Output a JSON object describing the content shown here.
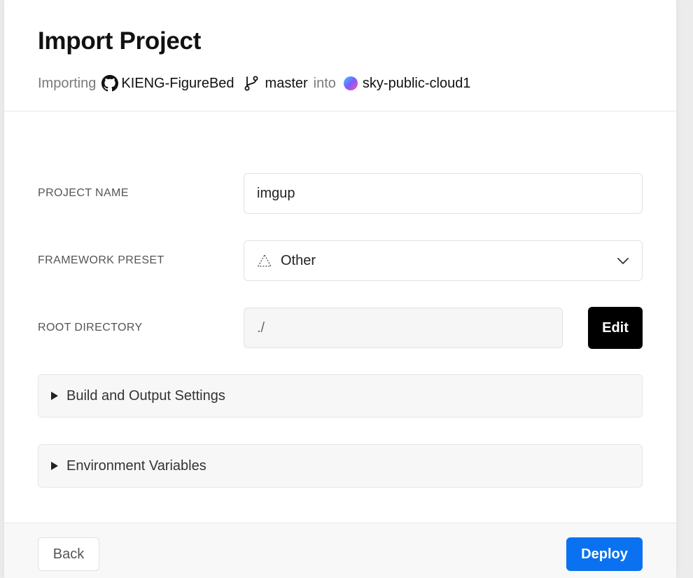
{
  "header": {
    "title": "Import Project",
    "importing_label": "Importing",
    "repo_name": "KIENG-FigureBed",
    "branch": "master",
    "into_label": "into",
    "team_name": "sky-public-cloud1"
  },
  "form": {
    "project_name_label": "PROJECT NAME",
    "project_name_value": "imgup",
    "framework_label": "FRAMEWORK PRESET",
    "framework_value": "Other",
    "root_dir_label": "ROOT DIRECTORY",
    "root_dir_value": "./",
    "edit_label": "Edit"
  },
  "sections": {
    "build_output": "Build and Output Settings",
    "env_vars": "Environment Variables"
  },
  "footer": {
    "back_label": "Back",
    "deploy_label": "Deploy"
  },
  "colors": {
    "accent": "#0a72f0",
    "edit_bg": "#000000"
  },
  "icons": {
    "repo": "github-icon",
    "branch": "git-branch-icon",
    "team": "team-avatar-icon",
    "framework": "other-framework-icon",
    "dropdown": "chevron-down-icon",
    "section": "triangle-right-icon"
  }
}
